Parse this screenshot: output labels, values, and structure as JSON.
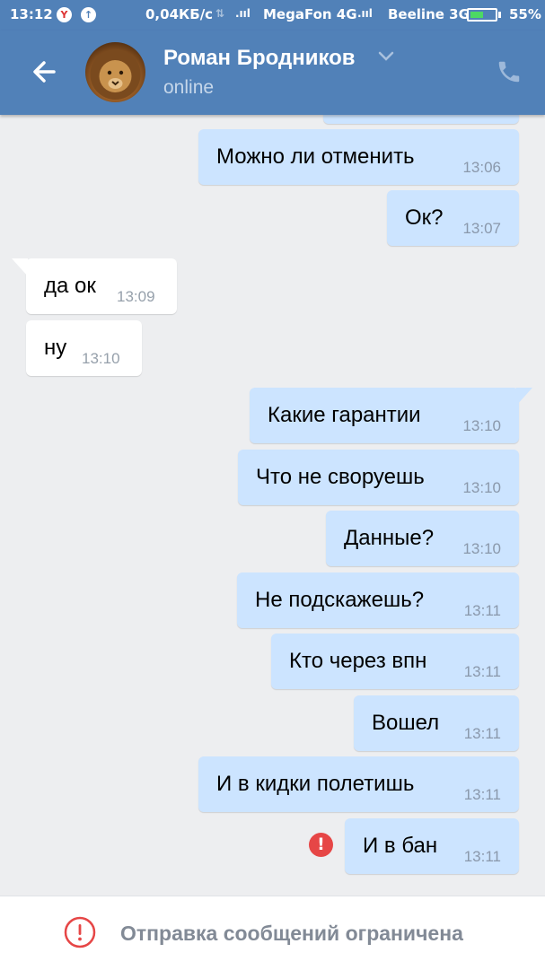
{
  "status_bar": {
    "time": "13:12",
    "net_speed": "0,04КБ/с",
    "operator1": "MegaFon 4G",
    "operator2": "Beeline 3G",
    "battery": "55%",
    "battery_level": 0.55
  },
  "header": {
    "contact_name": "Роман Бродников",
    "contact_status": "online",
    "icons": [
      "back-arrow-icon",
      "avatar",
      "chevron-down-icon",
      "phone-icon"
    ]
  },
  "messages": [
    {
      "dir": "out",
      "text": "Можно ли отменить",
      "time": "13:06"
    },
    {
      "dir": "out",
      "text": "Ок?",
      "time": "13:07"
    },
    {
      "dir": "in",
      "text": "да ок",
      "time": "13:09"
    },
    {
      "dir": "in",
      "text": "ну",
      "time": "13:10"
    },
    {
      "dir": "out",
      "text": "Какие гарантии",
      "time": "13:10"
    },
    {
      "dir": "out",
      "text": "Что не своруешь",
      "time": "13:10"
    },
    {
      "dir": "out",
      "text": "Данные?",
      "time": "13:10"
    },
    {
      "dir": "out",
      "text": "Не подскажешь?",
      "time": "13:11"
    },
    {
      "dir": "out",
      "text": "Кто через впн",
      "time": "13:11"
    },
    {
      "dir": "out",
      "text": "Вошел",
      "time": "13:11"
    },
    {
      "dir": "out",
      "text": "И в кидки полетишь",
      "time": "13:11"
    },
    {
      "dir": "out",
      "text": "И в бан",
      "time": "13:11",
      "error": true
    }
  ],
  "error_mark": "!",
  "bottom_bar": {
    "text": "Отправка сообщений ограничена"
  },
  "colors": {
    "header": "#5181b8",
    "bubble_out": "#cce4ff",
    "bubble_in": "#ffffff",
    "background": "#edeef0",
    "error": "#e64646"
  }
}
